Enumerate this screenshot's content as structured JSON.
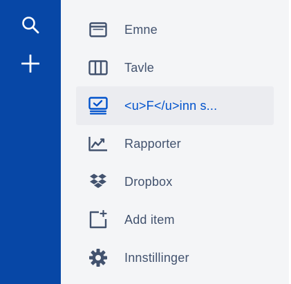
{
  "colors": {
    "global_nav_bg": "#0747a6",
    "sidebar_bg": "#f4f5f7",
    "selected_bg": "#ebecf0",
    "text": "#42526e",
    "accent": "#0052cc"
  },
  "global_nav": {
    "buttons": [
      {
        "icon": "search-icon"
      },
      {
        "icon": "plus-icon"
      }
    ]
  },
  "sidebar": {
    "items": [
      {
        "icon": "issues-icon",
        "label": "Emne",
        "selected": false
      },
      {
        "icon": "board-icon",
        "label": "Tavle",
        "selected": false
      },
      {
        "icon": "feature-icon",
        "label": "<u>F</u>inn s...",
        "selected": true
      },
      {
        "icon": "reports-icon",
        "label": "Rapporter",
        "selected": false
      },
      {
        "icon": "dropbox-icon",
        "label": "Dropbox",
        "selected": false
      },
      {
        "icon": "add-item-icon",
        "label": "Add item",
        "selected": false
      },
      {
        "icon": "gear-icon",
        "label": "Innstillinger",
        "selected": false
      }
    ]
  }
}
